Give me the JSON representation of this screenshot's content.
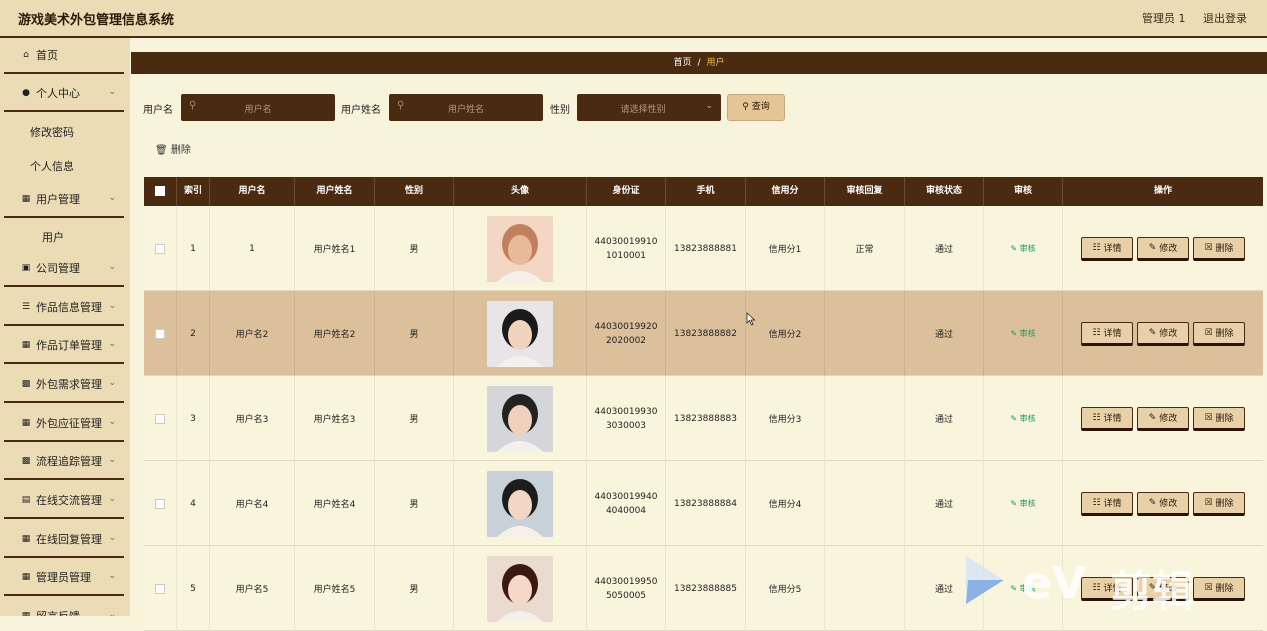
{
  "header": {
    "title": "游戏美术外包管理信息系统",
    "user": "管理员 1",
    "logout": "退出登录"
  },
  "sidebar": {
    "items": [
      {
        "label": "首页",
        "icon": "home-icon"
      },
      {
        "label": "个人中心",
        "icon": "user-icon"
      },
      {
        "label": "用户管理",
        "icon": "grid-icon"
      },
      {
        "label": "公司管理",
        "icon": "badge-icon"
      },
      {
        "label": "作品信息管理",
        "icon": "list-icon"
      },
      {
        "label": "作品订单管理",
        "icon": "table-icon"
      },
      {
        "label": "外包需求管理",
        "icon": "monitor-icon"
      },
      {
        "label": "外包应征管理",
        "icon": "grid-icon"
      },
      {
        "label": "流程追踪管理",
        "icon": "monitor-icon"
      },
      {
        "label": "在线交流管理",
        "icon": "bar-chart-icon"
      },
      {
        "label": "在线回复管理",
        "icon": "grid-icon"
      },
      {
        "label": "管理员管理",
        "icon": "grid-icon"
      },
      {
        "label": "留言反馈",
        "icon": "grid-icon"
      }
    ],
    "sub_items": {
      "personal_change_password": "修改密码",
      "personal_info": "个人信息",
      "user_list": "用户"
    }
  },
  "breadcrumb": {
    "home": "首页",
    "sep": "/",
    "current": "用户"
  },
  "search": {
    "username_label": "用户名",
    "username_placeholder": "用户名",
    "realname_label": "用户姓名",
    "realname_placeholder": "用户姓名",
    "gender_label": "性别",
    "gender_placeholder": "请选择性别",
    "search_button": "查询"
  },
  "toolbar": {
    "delete_label": "删除"
  },
  "table": {
    "columns": [
      "",
      "索引",
      "用户名",
      "用户姓名",
      "性别",
      "头像",
      "身份证",
      "手机",
      "信用分",
      "审核回复",
      "审核状态",
      "审核",
      "操作"
    ],
    "audit_label": "审核",
    "detail_label": "详情",
    "edit_label": "修改",
    "delete_label": "删除",
    "rows": [
      {
        "index": "1",
        "username": "1",
        "realname": "用户姓名1",
        "gender": "男",
        "idcard_1": "44030019910",
        "idcard_2": "1010001",
        "phone": "13823888881",
        "credit": "信用分1",
        "reply": "正常",
        "status": "通过"
      },
      {
        "index": "2",
        "username": "用户名2",
        "realname": "用户姓名2",
        "gender": "男",
        "idcard_1": "44030019920",
        "idcard_2": "2020002",
        "phone": "13823888882",
        "credit": "信用分2",
        "reply": "",
        "status": "通过"
      },
      {
        "index": "3",
        "username": "用户名3",
        "realname": "用户姓名3",
        "gender": "男",
        "idcard_1": "44030019930",
        "idcard_2": "3030003",
        "phone": "13823888883",
        "credit": "信用分3",
        "reply": "",
        "status": "通过"
      },
      {
        "index": "4",
        "username": "用户名4",
        "realname": "用户姓名4",
        "gender": "男",
        "idcard_1": "44030019940",
        "idcard_2": "4040004",
        "phone": "13823888884",
        "credit": "信用分4",
        "reply": "",
        "status": "通过"
      },
      {
        "index": "5",
        "username": "用户名5",
        "realname": "用户姓名5",
        "gender": "男",
        "idcard_1": "44030019950",
        "idcard_2": "5050005",
        "phone": "13823888885",
        "credit": "信用分5",
        "reply": "",
        "status": "通过"
      }
    ]
  },
  "watermark": {
    "text": "剪辑"
  },
  "colors": {
    "accent_dark": "#4a2a10",
    "sidebar_bg": "#ecdcb6",
    "page_bg": "#f8f4dc",
    "row_highlight": "#dcc09c",
    "audit_green": "#1a9a5a"
  }
}
